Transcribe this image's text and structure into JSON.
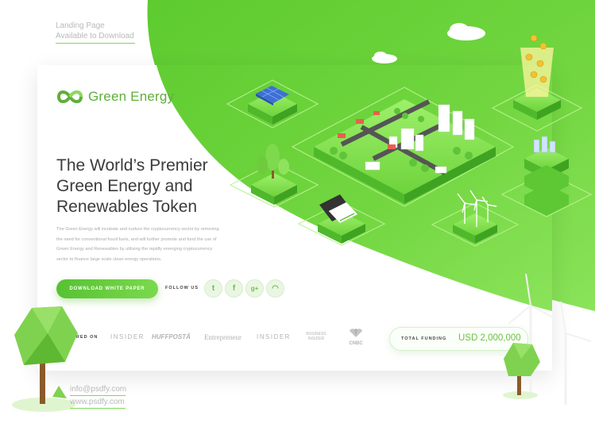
{
  "top_note": {
    "line1": "Landing Page",
    "line2": "Available to Download"
  },
  "brand": {
    "name": "Green Energy",
    "logo_icon": "infinity-leaf-icon"
  },
  "hero": {
    "headline_lines": [
      "The World’s Premier",
      "Green Energy and",
      "Renewables Token"
    ],
    "description_lines": [
      "The Green Energy will incubate and nurture the cryptocurrency sector by removing",
      "the need for conventional fossil fuels, and will further promote and fund the use of",
      "Green Energy and Renewables by utilising the rapidly emerging cryptocurrency",
      "sector to finance large scale clean energy operations."
    ]
  },
  "cta": {
    "download_label": "DOWNLOAD WHITE PAPER",
    "follow_label": "FOLLOW US"
  },
  "social": [
    {
      "name": "twitter",
      "icon": "twitter-icon",
      "glyph": "t"
    },
    {
      "name": "facebook",
      "icon": "facebook-icon",
      "glyph": "f"
    },
    {
      "name": "google-plus",
      "icon": "google-plus-icon",
      "glyph": "g+"
    },
    {
      "name": "rss",
      "icon": "rss-icon",
      "glyph": "◠"
    }
  ],
  "featured": {
    "label": "FEATURED ON",
    "logos": [
      "INSIDER",
      "HUFFPOSTÂ",
      "Entrepreneur",
      "INSIDER",
      "BUSINESS INSIDER",
      "CNBC"
    ]
  },
  "funding": {
    "label": "TOTAL FUNDING",
    "value": "USD 2,000,000"
  },
  "contact": {
    "email": "info@psdfy.com",
    "website": "www.psdfy.com"
  },
  "colors": {
    "brand_green": "#5fae3a",
    "blob_green": "#6fd13f",
    "accent_light": "#8fe25a"
  }
}
